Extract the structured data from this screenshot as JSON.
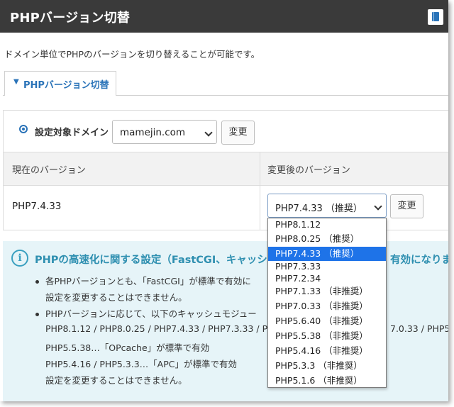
{
  "header": {
    "title": "PHPバージョン切替",
    "manual_icon": "book-icon"
  },
  "description": "ドメイン単位でPHPのバージョンを切り替えることが可能です。",
  "tab": {
    "label": "PHPバージョン切替",
    "icon": "chevron-down-icon"
  },
  "domain_select": {
    "label": "設定対象ドメイン",
    "value": "mamejin.com",
    "change_button": "変更"
  },
  "table": {
    "headers": [
      "現在のバージョン",
      "変更後のバージョン"
    ],
    "current_version": "PHP7.4.33",
    "new_version_value": "PHP7.4.33 （推奨）",
    "change_button": "変更"
  },
  "version_options": [
    "PHP8.1.12",
    "PHP8.0.25 （推奨）",
    "PHP7.4.33 （推奨）",
    "PHP7.3.33",
    "PHP7.2.34",
    "PHP7.1.33 （非推奨）",
    "PHP7.0.33 （非推奨）",
    "PHP5.6.40 （非推奨）",
    "PHP5.5.38 （非推奨）",
    "PHP5.4.16 （非推奨）",
    "PHP5.3.3 （非推奨）",
    "PHP5.1.6 （非推奨）"
  ],
  "selected_option_index": 2,
  "info": {
    "icon": "info-icon",
    "title": "PHPの高速化に関する設定（FastCGI、キャッシ",
    "title_tail": "有効になりま",
    "bullet1_line1": "各PHPバージョンとも、「FastCGI」が標準で有効に",
    "bullet1_line2": "設定を変更することはできません。",
    "bullet2_line1": "PHPバージョンに応じて、以下のキャッシュモジュー",
    "bullet2_line2": "PHP8.1.12 / PHP8.0.25 / PHP7.4.33 / PHP7.3.33 / P",
    "bullet2_line2_tail": "7.0.33 / PHP5.",
    "bullet2_line3": "PHP5.5.38…「OPcache」が標準で有効",
    "bullet2_line4": "PHP5.4.16 / PHP5.3.3…「APC」が標準で有効",
    "bullet2_line5": "設定を変更することはできません。"
  }
}
